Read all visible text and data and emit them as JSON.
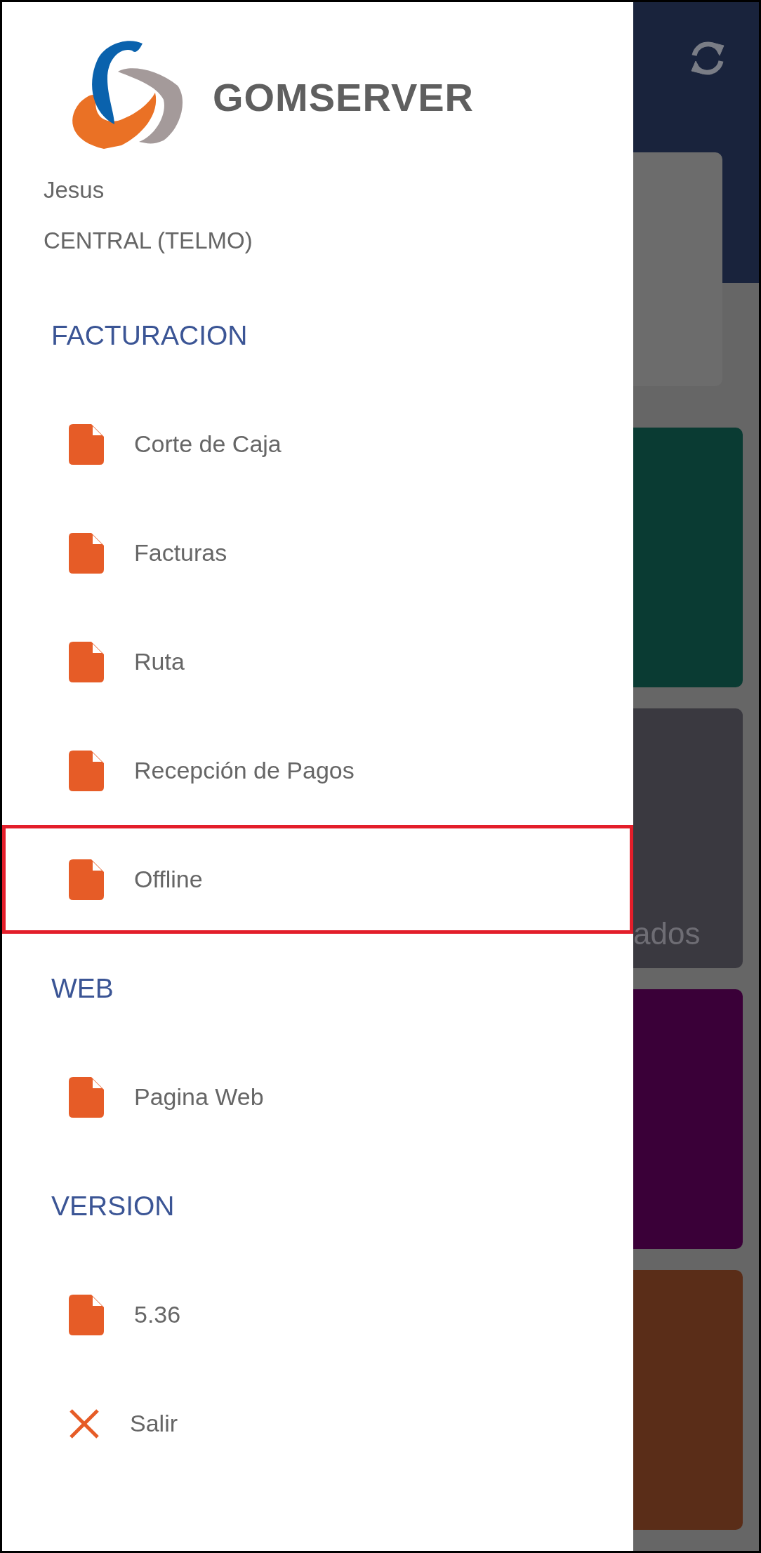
{
  "brand": {
    "name": "GOMSERVER"
  },
  "user": {
    "name": "Jesus",
    "branch": "CENTRAL (TELMO)"
  },
  "sections": [
    {
      "title": "FACTURACION",
      "items": [
        {
          "label": "Corte de Caja",
          "kind": "document",
          "highlighted": false
        },
        {
          "label": "Facturas",
          "kind": "document",
          "highlighted": false
        },
        {
          "label": "Ruta",
          "kind": "document",
          "highlighted": false
        },
        {
          "label": "Recepción de Pagos",
          "kind": "document",
          "highlighted": false
        },
        {
          "label": "Offline",
          "kind": "document",
          "highlighted": true
        }
      ]
    },
    {
      "title": "WEB",
      "items": [
        {
          "label": "Pagina Web",
          "kind": "document",
          "highlighted": false
        }
      ]
    },
    {
      "title": "VERSION",
      "items": [
        {
          "label": "5.36",
          "kind": "document",
          "highlighted": false
        },
        {
          "label": "Salir",
          "kind": "exit",
          "highlighted": false
        }
      ]
    }
  ],
  "background": {
    "cards": [
      {
        "color": "#0a3b33"
      },
      {
        "color": "#3a3940",
        "text": "ados"
      },
      {
        "color": "#3a0038"
      },
      {
        "color": "#5a2d18"
      }
    ]
  }
}
